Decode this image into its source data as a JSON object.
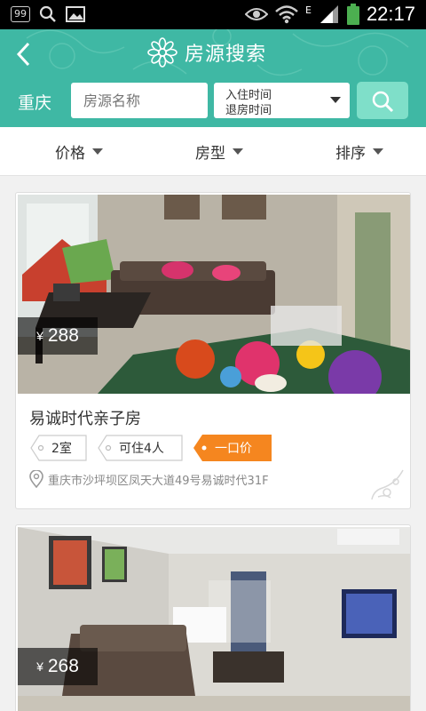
{
  "status_bar": {
    "badge": "99",
    "network": "E",
    "time": "22:17"
  },
  "header": {
    "title": "房源搜索",
    "city": "重庆"
  },
  "search": {
    "placeholder": "房源名称",
    "date_in": "入住时间",
    "date_out": "退房时间"
  },
  "filters": [
    {
      "label": "价格"
    },
    {
      "label": "房型"
    },
    {
      "label": "排序"
    }
  ],
  "listings": [
    {
      "currency": "¥",
      "price": "288",
      "name": "易诚时代亲子房",
      "tags": [
        "2室",
        "可住4人",
        "一口价"
      ],
      "address": "重庆市沙坪坝区凤天大道49号易诚时代31F"
    },
    {
      "currency": "¥",
      "price": "268"
    }
  ],
  "colors": {
    "accent": "#3fb8a4",
    "search_button": "#7fdfc9",
    "tag_highlight": "#f5861f"
  }
}
